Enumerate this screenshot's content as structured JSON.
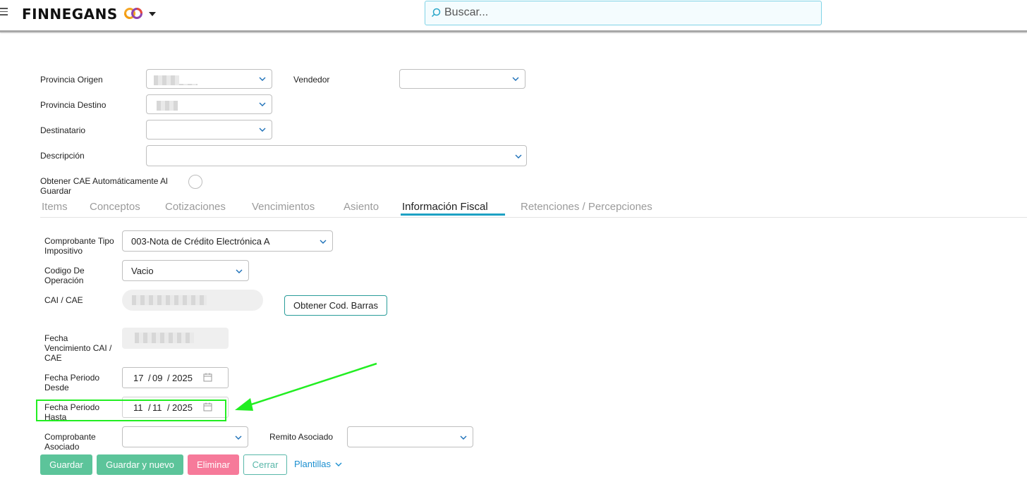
{
  "header": {
    "brand": "FINNEGANS",
    "search_placeholder": "Buscar..."
  },
  "form": {
    "provincia_origen": {
      "label": "Provincia Origen"
    },
    "vendedor": {
      "label": "Vendedor"
    },
    "provincia_destino": {
      "label": "Provincia Destino"
    },
    "destinatario": {
      "label": "Destinatario"
    },
    "descripcion": {
      "label": "Descripción"
    },
    "cae_auto": {
      "label_line1": "Obtener CAE Automáticamente Al",
      "label_line2": "Guardar"
    }
  },
  "tabs": [
    {
      "label": "Items"
    },
    {
      "label": "Conceptos"
    },
    {
      "label": "Cotizaciones"
    },
    {
      "label": "Vencimientos"
    },
    {
      "label": "Asiento"
    },
    {
      "label": "Información Fiscal",
      "active": true
    },
    {
      "label": "Retenciones / Percepciones"
    }
  ],
  "fiscal": {
    "comprobante_tipo": {
      "label_line1": "Comprobante Tipo",
      "label_line2": "Impositivo",
      "value": "003-Nota de Crédito Electrónica A"
    },
    "codigo_operacion": {
      "label_line1": "Codigo De",
      "label_line2": "Operación",
      "value": "Vacio"
    },
    "cai_cae": {
      "label": "CAI / CAE"
    },
    "obtener_barras": "Obtener Cod. Barras",
    "fecha_venc": {
      "label_line1": "Fecha",
      "label_line2": "Vencimiento CAI /",
      "label_line3": "CAE"
    },
    "fecha_desde": {
      "label_line1": "Fecha Periodo",
      "label_line2": "Desde",
      "day": "17",
      "month": "09",
      "year": "2025"
    },
    "fecha_hasta": {
      "label_line1": "Fecha Periodo",
      "label_line2": "Hasta",
      "day": "11",
      "month": "11",
      "year": "2025"
    },
    "comprobante_asociado": {
      "label_line1": "Comprobante",
      "label_line2": "Asociado"
    },
    "remito_asociado": {
      "label": "Remito Asociado"
    }
  },
  "actions": {
    "guardar": "Guardar",
    "guardar_nuevo": "Guardar y nuevo",
    "eliminar": "Eliminar",
    "cerrar": "Cerrar",
    "plantillas": "Plantillas"
  },
  "colors": {
    "accent": "#1da1c4",
    "green": "#5cc49a",
    "pink": "#f67a9a",
    "annotation": "#22ee22"
  }
}
